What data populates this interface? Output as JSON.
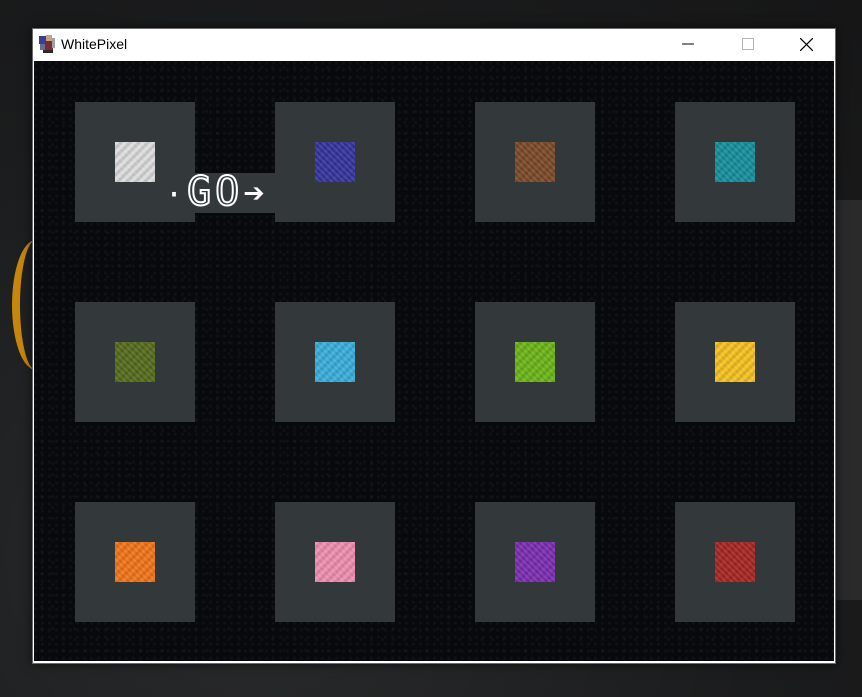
{
  "window": {
    "title": "WhitePixel",
    "controls": {
      "minimize": "minimize",
      "maximize": "maximize",
      "close": "close"
    }
  },
  "start_label": {
    "dot": "·",
    "text": "GO",
    "arrow": "➔"
  },
  "tiles": [
    {
      "name": "tile-white",
      "color": "#dcdcdc",
      "row": 0,
      "col": 0
    },
    {
      "name": "tile-blue",
      "color": "#34349c",
      "row": 0,
      "col": 1
    },
    {
      "name": "tile-brown",
      "color": "#7a4a2a",
      "row": 0,
      "col": 2
    },
    {
      "name": "tile-cyan",
      "color": "#168f9c",
      "row": 0,
      "col": 3
    },
    {
      "name": "tile-olive",
      "color": "#566b1e",
      "row": 1,
      "col": 0
    },
    {
      "name": "tile-light-blue",
      "color": "#3aaedc",
      "row": 1,
      "col": 1
    },
    {
      "name": "tile-lime",
      "color": "#6cb418",
      "row": 1,
      "col": 2
    },
    {
      "name": "tile-yellow",
      "color": "#f5c121",
      "row": 1,
      "col": 3
    },
    {
      "name": "tile-orange",
      "color": "#f0751a",
      "row": 2,
      "col": 0
    },
    {
      "name": "tile-pink",
      "color": "#ee8fb0",
      "row": 2,
      "col": 1
    },
    {
      "name": "tile-purple",
      "color": "#7a2eb0",
      "row": 2,
      "col": 2
    },
    {
      "name": "tile-red",
      "color": "#a62623",
      "row": 2,
      "col": 3
    }
  ]
}
